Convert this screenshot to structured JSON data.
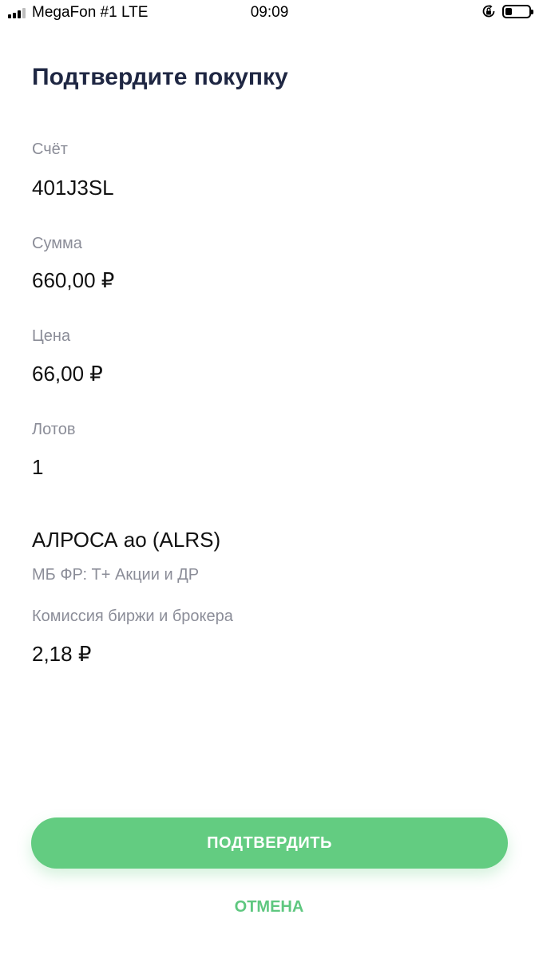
{
  "status_bar": {
    "carrier": "MegaFon #1 LTE",
    "time": "09:09",
    "signal_bars": 3,
    "battery_level": 0.3,
    "icons": [
      "signal-icon",
      "orientation-lock-icon",
      "battery-icon"
    ]
  },
  "page": {
    "title": "Подтвердите покупку"
  },
  "fields": {
    "account": {
      "label": "Счёт",
      "value": "401J3SL"
    },
    "amount": {
      "label": "Сумма",
      "value": "660,00 ₽"
    },
    "price": {
      "label": "Цена",
      "value": "66,00 ₽"
    },
    "lots": {
      "label": "Лотов",
      "value": "1"
    }
  },
  "instrument": {
    "name": "АЛРОСА ао (ALRS)",
    "market": "МБ ФР: Т+ Акции и ДР"
  },
  "commission": {
    "label": "Комиссия биржи и брокера",
    "value": "2,18 ₽"
  },
  "actions": {
    "confirm_label": "ПОДТВЕРДИТЬ",
    "cancel_label": "ОТМЕНА"
  },
  "colors": {
    "title": "#1f2743",
    "label": "#8b8d98",
    "accent": "#63cc81",
    "cancel_text": "#5ec77f"
  }
}
